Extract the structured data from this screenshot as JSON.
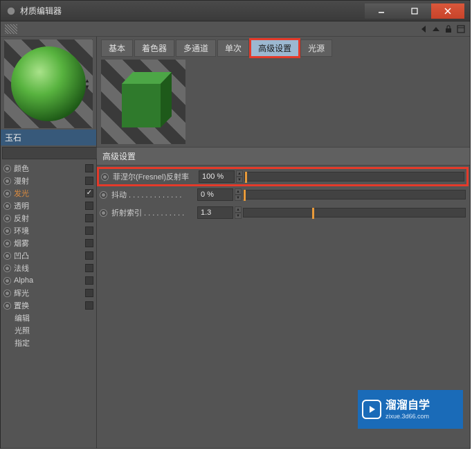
{
  "window": {
    "title": "材质编辑器"
  },
  "material": {
    "name": "玉石"
  },
  "tabs": [
    "基本",
    "着色器",
    "多通道",
    "单次",
    "高级设置",
    "光源"
  ],
  "active_tab": "高级设置",
  "section": "高级设置",
  "channels": [
    {
      "label": "颜色",
      "checked": false,
      "active": false
    },
    {
      "label": "漫射",
      "checked": false,
      "active": false
    },
    {
      "label": "发光",
      "checked": true,
      "active": true
    },
    {
      "label": "透明",
      "checked": false,
      "active": false
    },
    {
      "label": "反射",
      "checked": false,
      "active": false
    },
    {
      "label": "环境",
      "checked": false,
      "active": false
    },
    {
      "label": "烟雾",
      "checked": false,
      "active": false
    },
    {
      "label": "凹凸",
      "checked": false,
      "active": false
    },
    {
      "label": "法线",
      "checked": false,
      "active": false
    },
    {
      "label": "Alpha",
      "checked": false,
      "active": false
    },
    {
      "label": "辉光",
      "checked": false,
      "active": false
    },
    {
      "label": "置换",
      "checked": false,
      "active": false
    }
  ],
  "subchannels": [
    "编辑",
    "光照",
    "指定"
  ],
  "props": {
    "fresnel": {
      "label": "菲涅尔(Fresnel)反射率",
      "value": "100 %",
      "handle_pct": 0
    },
    "jitter": {
      "label": "抖动 . . . . . . . . . . . . .",
      "value": "0 %",
      "handle_pct": 0
    },
    "ior": {
      "label": "折射索引 . . . . . . . . . .",
      "value": "1.3",
      "handle_pct": 31
    }
  },
  "watermark": {
    "brand": "溜溜自学",
    "url": "zixue.3d66.com"
  }
}
